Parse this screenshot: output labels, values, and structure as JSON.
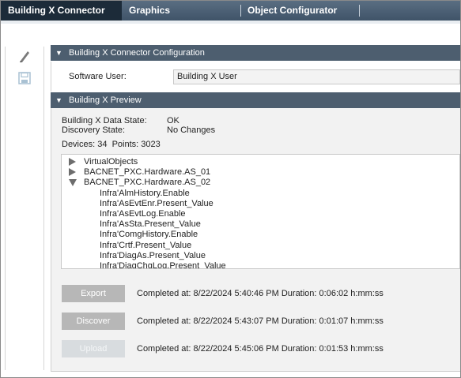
{
  "tabs": [
    {
      "label": "Building X Connector",
      "active": true
    },
    {
      "label": "Graphics",
      "active": false
    },
    {
      "label": "Object Configurator",
      "active": false
    }
  ],
  "toolbar": {
    "edit_icon": "pencil-icon",
    "save_icon": "save-disk-icon"
  },
  "config": {
    "title": "Building X Connector Configuration",
    "software_user_label": "Software User:",
    "software_user_value": "Building X User"
  },
  "preview": {
    "title": "Building X Preview",
    "data_state_label": "Building X Data State:",
    "data_state_value": "OK",
    "discovery_state_label": "Discovery State:",
    "discovery_state_value": "No Changes",
    "counts": "Devices: 34  Points: 3023",
    "tree": [
      {
        "label": "VirtualObjects",
        "state": "collapsed",
        "level": 0
      },
      {
        "label": "BACNET_PXC.Hardware.AS_01",
        "state": "collapsed",
        "level": 0
      },
      {
        "label": "BACNET_PXC.Hardware.AS_02",
        "state": "expanded",
        "level": 0
      },
      {
        "label": "Infra'AlmHistory.Enable",
        "level": 1
      },
      {
        "label": "Infra'AsEvtEnr.Present_Value",
        "level": 1
      },
      {
        "label": "Infra'AsEvtLog.Enable",
        "level": 1
      },
      {
        "label": "Infra'AsSta.Present_Value",
        "level": 1
      },
      {
        "label": "Infra'ComgHistory.Enable",
        "level": 1
      },
      {
        "label": "Infra'Crtf.Present_Value",
        "level": 1
      },
      {
        "label": "Infra'DiagAs.Present_Value",
        "level": 1
      },
      {
        "label": "Infra'DiagChgLog.Present_Value",
        "level": 1
      }
    ]
  },
  "actions": [
    {
      "label": "Export",
      "status": "Completed at: 8/22/2024 5:40:46 PM Duration: 0:06:02 h:mm:ss",
      "enabled": true
    },
    {
      "label": "Discover",
      "status": "Completed at: 8/22/2024 5:43:07 PM Duration: 0:01:07 h:mm:ss",
      "enabled": true
    },
    {
      "label": "Upload",
      "status": "Completed at: 8/22/2024 5:45:06 PM Duration: 0:01:53 h:mm:ss",
      "enabled": false
    }
  ]
}
